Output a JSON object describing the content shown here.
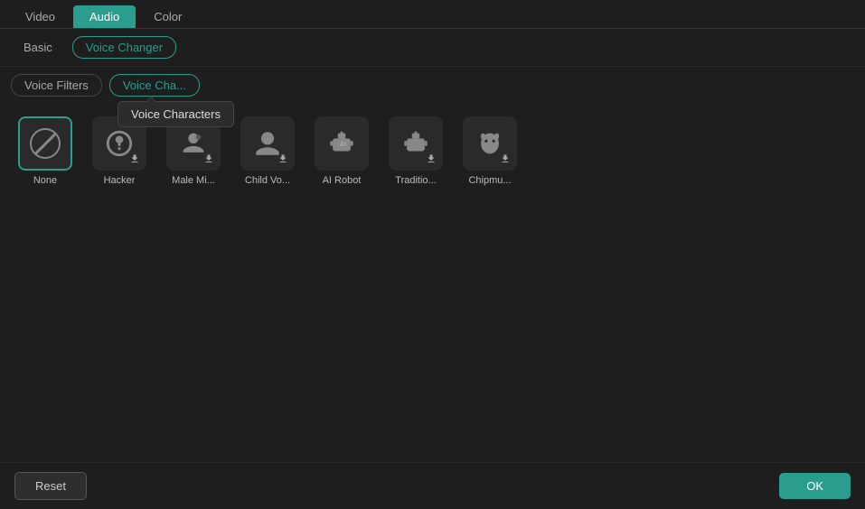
{
  "tabs": {
    "top": [
      {
        "id": "video",
        "label": "Video",
        "active": false
      },
      {
        "id": "audio",
        "label": "Audio",
        "active": true
      },
      {
        "id": "color",
        "label": "Color",
        "active": false
      }
    ],
    "sub": [
      {
        "id": "basic",
        "label": "Basic",
        "active": false
      },
      {
        "id": "voice-changer",
        "label": "Voice Changer",
        "active": true
      }
    ],
    "filter": [
      {
        "id": "voice-filters",
        "label": "Voice Filters",
        "active": false
      },
      {
        "id": "voice-characters",
        "label": "Voice Cha...",
        "active": true
      }
    ]
  },
  "tooltip": {
    "text": "Voice Characters"
  },
  "characters": [
    {
      "id": "none",
      "label": "None",
      "icon": "none",
      "selected": true,
      "downloadable": false
    },
    {
      "id": "hacker",
      "label": "Hacker",
      "icon": "hacker",
      "selected": false,
      "downloadable": true
    },
    {
      "id": "male-mi",
      "label": "Male Mi...",
      "icon": "male-mi",
      "selected": false,
      "downloadable": true
    },
    {
      "id": "child-vo",
      "label": "Child Vo...",
      "icon": "child-vo",
      "selected": false,
      "downloadable": true
    },
    {
      "id": "ai-robot",
      "label": "AI Robot",
      "icon": "ai-robot",
      "selected": false,
      "downloadable": false
    },
    {
      "id": "traditio",
      "label": "Traditio...",
      "icon": "traditio",
      "selected": false,
      "downloadable": true
    },
    {
      "id": "chipmun",
      "label": "Chipmu...",
      "icon": "chipmun",
      "selected": false,
      "downloadable": true
    }
  ],
  "buttons": {
    "reset": "Reset",
    "ok": "OK"
  }
}
